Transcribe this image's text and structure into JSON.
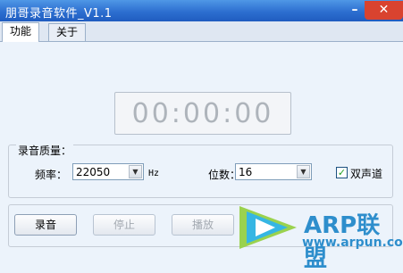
{
  "window": {
    "title": "朋哥录音软件_V1.1",
    "minimize_glyph": "–",
    "close_glyph": "✕"
  },
  "tabs": [
    {
      "label": "功能"
    },
    {
      "label": "关于"
    }
  ],
  "timer": {
    "display": "00:00:00"
  },
  "quality": {
    "title": "录音质量：",
    "frequency_label": "频率：",
    "frequency_value": "22050",
    "frequency_unit": "Hz",
    "bits_label": "位数：",
    "bits_value": "16",
    "stereo_label": "双声道",
    "stereo_checked": true
  },
  "controls": {
    "record": "录音",
    "stop": "停止",
    "play": "播放"
  },
  "watermark": {
    "brand": "ARP联盟",
    "url": "www.arpun.com"
  },
  "colors": {
    "titlebar": "#2d6fd0",
    "close": "#d9432f",
    "brand": "#2e8ecc"
  }
}
